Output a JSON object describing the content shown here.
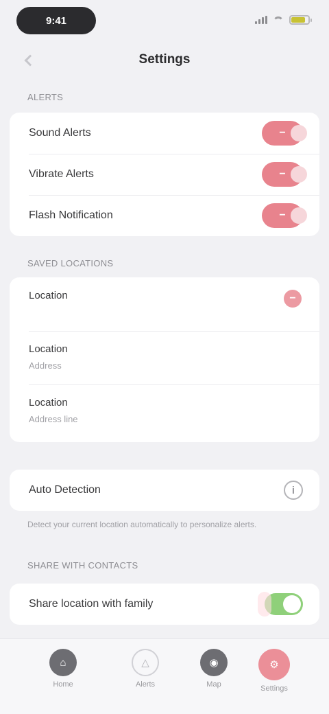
{
  "status_bar": {
    "time": "9:41",
    "battery_level": 0.85,
    "battery_color": "#c8c234"
  },
  "nav": {
    "title": "Settings"
  },
  "section_1": {
    "header": "ALERTS",
    "rows": [
      {
        "label": "Sound Alerts",
        "badge": "−"
      },
      {
        "label": "Vibrate Alerts",
        "badge": "−"
      },
      {
        "label": "Flash Notification",
        "badge": "−"
      }
    ]
  },
  "section_2": {
    "header": "SAVED LOCATIONS",
    "items": [
      {
        "title": "Location",
        "detail": "",
        "remove": "−"
      },
      {
        "title": "Location",
        "detail": "Address"
      },
      {
        "title": "Location",
        "detail": "Address line"
      }
    ]
  },
  "section_3": {
    "row_label": "Auto Detection",
    "info": "i",
    "footer": "Detect your current location automatically to personalize alerts."
  },
  "section_4": {
    "header": "SHARE WITH CONTACTS",
    "row_label": "Share location with family",
    "toggle_on": true
  },
  "tabs": [
    {
      "icon": "home-icon",
      "label": "Home"
    },
    {
      "icon": "alerts-icon",
      "label": "Alerts"
    },
    {
      "icon": "map-icon",
      "label": "Map"
    },
    {
      "icon": "settings-icon",
      "label": "Settings"
    }
  ],
  "colors": {
    "accent_red": "#e8838d",
    "toggle_green": "#8fd07a"
  }
}
